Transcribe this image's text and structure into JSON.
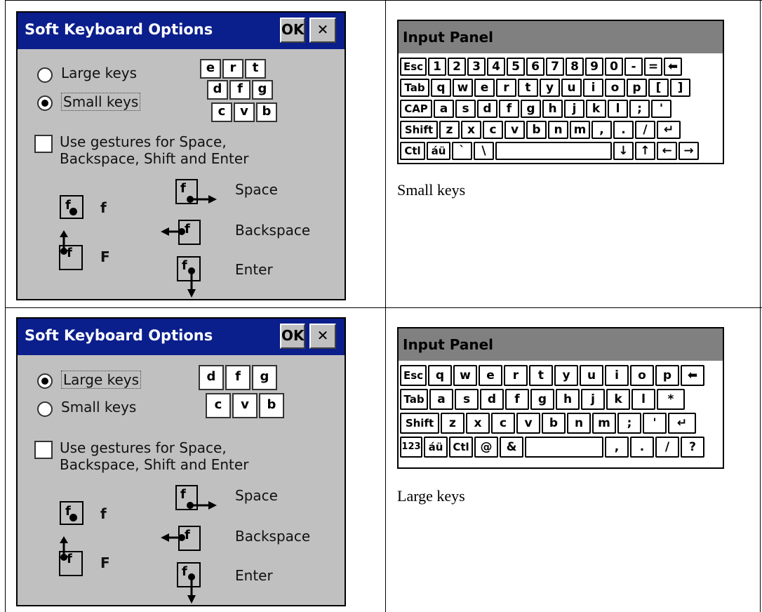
{
  "top": {
    "dialog": {
      "title": "Soft Keyboard Options",
      "ok_label": "OK",
      "close_label": "✕",
      "option1": "Large keys",
      "option2": "Small keys",
      "selected": "Small keys",
      "illustration_rows": [
        [
          "e",
          "r",
          "t"
        ],
        [
          "d",
          "f",
          "g"
        ],
        [
          "c",
          "v",
          "b"
        ]
      ],
      "gesture_checkbox": "Use gestures for Space, Backspace, Shift and Enter",
      "gesture_checked": false,
      "g_f": "f",
      "g_F": "F",
      "g_space": "Space",
      "g_backspace": "Backspace",
      "g_enter": "Enter",
      "key_f": "f"
    },
    "panel": {
      "title": "Input Panel",
      "rows": [
        [
          "Esc",
          "1",
          "2",
          "3",
          "4",
          "5",
          "6",
          "7",
          "8",
          "9",
          "0",
          "-",
          "=",
          "⬅"
        ],
        [
          "Tab",
          "q",
          "w",
          "e",
          "r",
          "t",
          "y",
          "u",
          "i",
          "o",
          "p",
          "[",
          "]"
        ],
        [
          "CAP",
          "a",
          "s",
          "d",
          "f",
          "g",
          "h",
          "j",
          "k",
          "l",
          ";",
          "'"
        ],
        [
          "Shift",
          "z",
          "x",
          "c",
          "v",
          "b",
          "n",
          "m",
          ",",
          ".",
          "/",
          "↵"
        ],
        [
          "Ctl",
          "áü",
          "`",
          "\\",
          "",
          "↓",
          "↑",
          "←",
          "→"
        ]
      ]
    },
    "caption": "Small keys"
  },
  "bottom": {
    "dialog": {
      "title": "Soft Keyboard Options",
      "ok_label": "OK",
      "close_label": "✕",
      "option1": "Large keys",
      "option2": "Small keys",
      "selected": "Large keys",
      "illustration_rows": [
        [
          "d",
          "f",
          "g"
        ],
        [
          "c",
          "v",
          "b"
        ]
      ],
      "gesture_checkbox": "Use gestures for Space, Backspace, Shift and Enter",
      "gesture_checked": false,
      "g_f": "f",
      "g_F": "F",
      "g_space": "Space",
      "g_backspace": "Backspace",
      "g_enter": "Enter",
      "key_f": "f"
    },
    "panel": {
      "title": "Input Panel",
      "rows": [
        [
          "Esc",
          "q",
          "w",
          "e",
          "r",
          "t",
          "y",
          "u",
          "i",
          "o",
          "p",
          "⬅"
        ],
        [
          "Tab",
          "a",
          "s",
          "d",
          "f",
          "g",
          "h",
          "j",
          "k",
          "l",
          "*"
        ],
        [
          "Shift",
          "z",
          "x",
          "c",
          "v",
          "b",
          "n",
          "m",
          ";",
          "'",
          "↵"
        ],
        [
          "123",
          "áü",
          "Ctl",
          "@",
          "&",
          "",
          ",",
          ".",
          "/",
          "?"
        ]
      ]
    },
    "caption": "Large keys"
  }
}
